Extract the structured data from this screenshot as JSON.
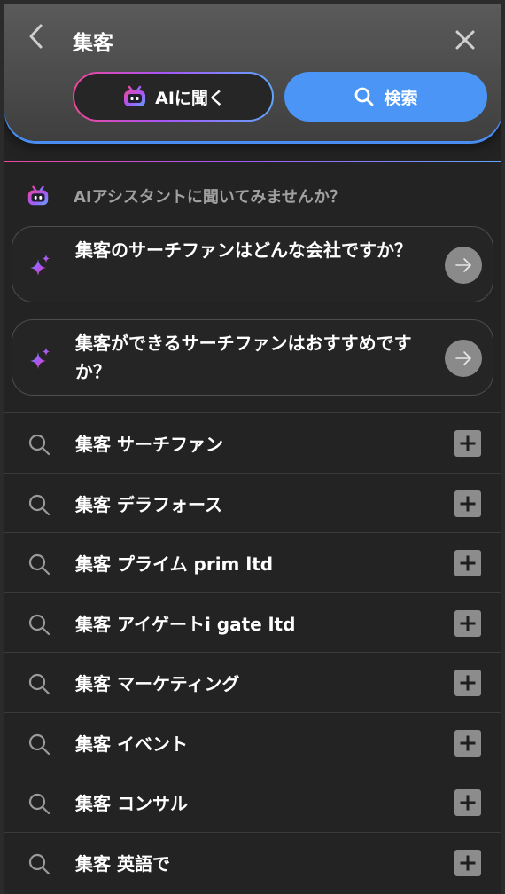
{
  "header": {
    "title": "集客",
    "ai_button_label": "AIに聞く",
    "search_button_label": "検索"
  },
  "assistant": {
    "prompt": "AIアシスタントに聞いてみませんか？",
    "suggestions": [
      {
        "text": "集客のサーチファンはどんな会社ですか？"
      },
      {
        "text": "集客ができるサーチファンはおすすめですか？"
      }
    ]
  },
  "results": [
    {
      "text": "集客 サーチファン"
    },
    {
      "text": "集客 デラフォース"
    },
    {
      "text": "集客 プライム prim ltd"
    },
    {
      "text": "集客 アイゲートi gate ltd"
    },
    {
      "text": "集客 マーケティング"
    },
    {
      "text": "集客 イベント"
    },
    {
      "text": "集客 コンサル"
    },
    {
      "text": "集客 英語で"
    }
  ],
  "colors": {
    "accent_blue": "#4a95f6",
    "gradient_pink": "#ec4899",
    "gradient_purple": "#a855f7",
    "gradient_blue": "#60a5fa"
  },
  "icons": [
    "back-icon",
    "close-icon",
    "robot-icon",
    "search-icon",
    "sparkle-icon",
    "arrow-right-icon",
    "plus-icon"
  ]
}
